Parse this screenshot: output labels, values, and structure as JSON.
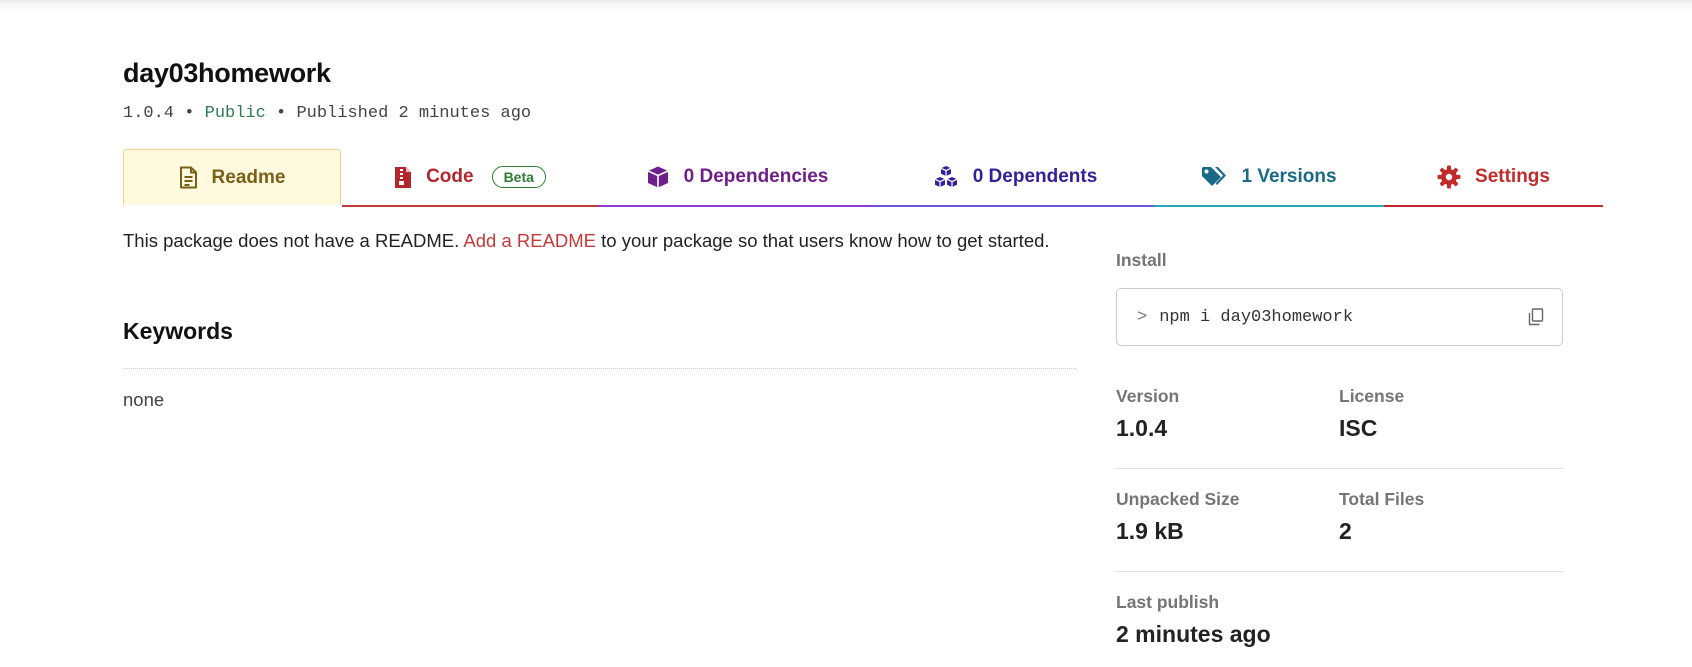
{
  "package": {
    "name": "day03homework",
    "version": "1.0.4",
    "separator": "•",
    "visibility": "Public",
    "published": "Published 2 minutes ago"
  },
  "tabs": {
    "readme": "Readme",
    "code": "Code",
    "code_badge": "Beta",
    "dependencies": "0 Dependencies",
    "dependents": "0 Dependents",
    "versions": "1 Versions",
    "settings": "Settings"
  },
  "readme": {
    "text_before": "This package does not have a README. ",
    "link": "Add a README",
    "text_after": " to your package so that users know how to get started."
  },
  "keywords": {
    "title": "Keywords",
    "value": "none"
  },
  "sidebar": {
    "install_label": "Install",
    "prompt": ">",
    "install_command": "npm i day03homework",
    "copy_icon": "copy-icon",
    "version_label": "Version",
    "version_value": "1.0.4",
    "license_label": "License",
    "license_value": "ISC",
    "size_label": "Unpacked Size",
    "size_value": "1.9 kB",
    "files_label": "Total Files",
    "files_value": "2",
    "last_publish_label": "Last publish",
    "last_publish_value": "2 minutes ago"
  },
  "colors": {
    "readme": "#7a5f17",
    "code": "#b3262d",
    "dependencies": "#6f1f8c",
    "dependents": "#35209a",
    "versions": "#1a6a86",
    "settings": "#c22b2b",
    "public": "#2e7d52"
  }
}
